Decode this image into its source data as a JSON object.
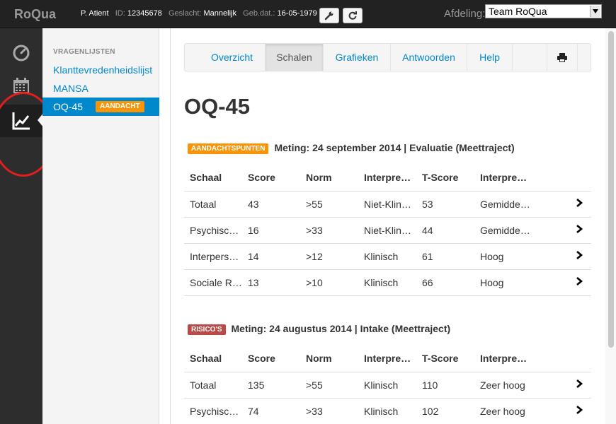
{
  "topbar": {
    "brand": "RoQua",
    "patient_name": "P. Atient",
    "id_label": "ID:",
    "id_value": "12345678",
    "gender_label": "Geslacht:",
    "gender_value": "Mannelijk",
    "dob_label": "Geb.dat.:",
    "dob_value": "16-05-1979",
    "department_label": "Afdeling:",
    "department_value": "Team RoQua"
  },
  "rail": {
    "items": [
      {
        "icon": "dashboard-icon"
      },
      {
        "icon": "calendar-icon"
      },
      {
        "icon": "chart-icon",
        "active": true
      }
    ]
  },
  "subnav": {
    "title": "VRAGENLIJSTEN",
    "items": [
      {
        "label": "Klanttevredenheidslijst"
      },
      {
        "label": "MANSA"
      },
      {
        "label": "OQ-45",
        "badge": "AANDACHT",
        "active": true
      }
    ]
  },
  "tabs": {
    "overview": "Overzicht",
    "scales": "Schalen",
    "charts": "Grafieken",
    "answers": "Antwoorden",
    "help": "Help"
  },
  "page": {
    "title": "OQ-45"
  },
  "sections": [
    {
      "label": "AANDACHTSPUNTEN",
      "heading": "Meting: 24 september 2014 | Evaluatie (Meettraject)",
      "columns": [
        "Schaal",
        "Score",
        "Norm",
        "Interpre…",
        "T-Score",
        "Interpre…"
      ],
      "rows": [
        [
          "Totaal",
          "43",
          ">55",
          "Niet-Klin…",
          "53",
          "Gemidde…"
        ],
        [
          "Psychisc…",
          "16",
          ">33",
          "Niet-Klin…",
          "44",
          "Gemidde…"
        ],
        [
          "Interpers…",
          "14",
          ">12",
          "Klinisch",
          "61",
          "Hoog"
        ],
        [
          "Sociale R…",
          "13",
          ">10",
          "Klinisch",
          "66",
          "Hoog"
        ]
      ]
    },
    {
      "label": "RISICO'S",
      "heading": "Meting: 24 augustus 2014 | Intake (Meettraject)",
      "columns": [
        "Schaal",
        "Score",
        "Norm",
        "Interpre…",
        "T-Score",
        "Interpre…"
      ],
      "rows": [
        [
          "Totaal",
          "135",
          ">55",
          "Klinisch",
          "110",
          "Zeer hoog"
        ],
        [
          "Psychisc…",
          "74",
          ">33",
          "Klinisch",
          "102",
          "Zeer hoog"
        ]
      ]
    }
  ],
  "colors": {
    "link": "#0088cc",
    "warning": "#f89406",
    "danger": "#b94a48",
    "annotation_circle": "#e21e1e"
  }
}
